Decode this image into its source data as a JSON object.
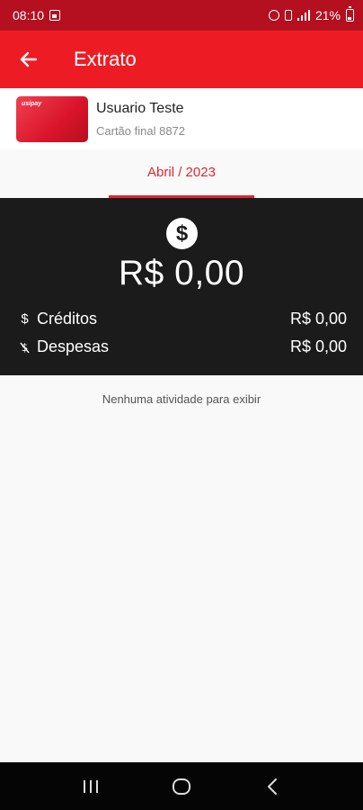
{
  "status_bar": {
    "time": "08:10",
    "battery": "21%"
  },
  "app_bar": {
    "title": "Extrato"
  },
  "card": {
    "brand": "usipay",
    "user_name": "Usuario Teste",
    "card_final": "Cartão final 8872"
  },
  "month_tab": {
    "label": "Abril / 2023"
  },
  "summary": {
    "total": "R$  0,00",
    "credits_label": "Créditos",
    "credits_value": "R$  0,00",
    "expenses_label": "Despesas",
    "expenses_value": "R$  0,00"
  },
  "empty_state": {
    "message": "Nenhuma atividade para exibir"
  },
  "colors": {
    "status_bar": "#b51020",
    "app_bar": "#ed1c24",
    "accent": "#e02631",
    "summary_bg": "#1b1b1b",
    "nav_bar": "#050505"
  }
}
